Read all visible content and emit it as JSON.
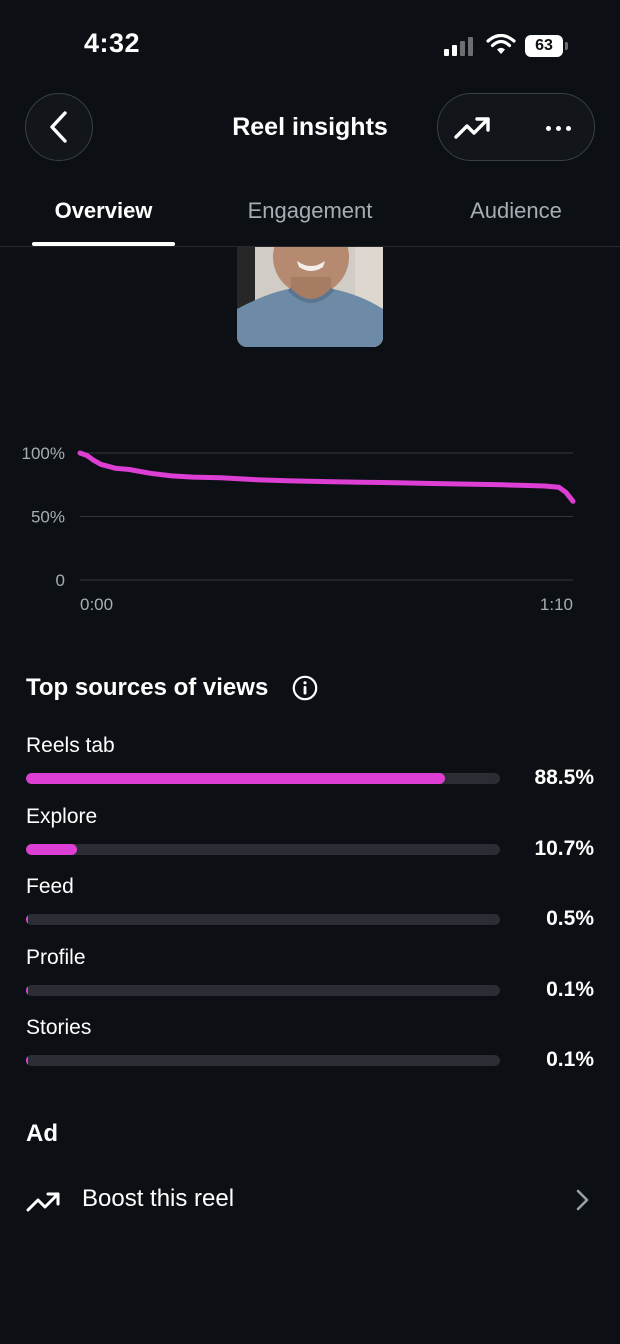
{
  "status_bar": {
    "time": "4:32",
    "battery": "63"
  },
  "header": {
    "title": "Reel insights"
  },
  "tabs": [
    {
      "label": "Overview",
      "active": true
    },
    {
      "label": "Engagement",
      "active": false
    },
    {
      "label": "Audience",
      "active": false
    }
  ],
  "chart_data": {
    "type": "line",
    "title": "",
    "x_tick_labels": [
      "0:00",
      "1:10"
    ],
    "y_tick_labels": [
      "100%",
      "50%",
      "0"
    ],
    "ylim": [
      0,
      100
    ],
    "xlim_seconds": [
      0,
      70
    ],
    "grid": true,
    "series": [
      {
        "color": "#dd3fd5",
        "x_seconds": [
          0,
          1,
          2,
          3,
          5,
          7,
          10,
          13,
          16,
          20,
          25,
          30,
          35,
          40,
          45,
          50,
          55,
          60,
          63,
          66,
          68,
          69,
          70
        ],
        "values": [
          100,
          98,
          94,
          91,
          88,
          87,
          84,
          82,
          81,
          80.5,
          79,
          78,
          77.5,
          77,
          76.5,
          76,
          75.5,
          75,
          74.5,
          74,
          73,
          69,
          62
        ]
      }
    ]
  },
  "sources": {
    "title": "Top sources of views",
    "accent_color": "#dd3fd5",
    "items": [
      {
        "label": "Reels tab",
        "percent_text": "88.5%",
        "value": 88.5
      },
      {
        "label": "Explore",
        "percent_text": "10.7%",
        "value": 10.7
      },
      {
        "label": "Feed",
        "percent_text": "0.5%",
        "value": 0.5
      },
      {
        "label": "Profile",
        "percent_text": "0.1%",
        "value": 0.1
      },
      {
        "label": "Stories",
        "percent_text": "0.1%",
        "value": 0.1
      }
    ]
  },
  "ad": {
    "heading": "Ad",
    "boost_label": "Boost this reel"
  }
}
